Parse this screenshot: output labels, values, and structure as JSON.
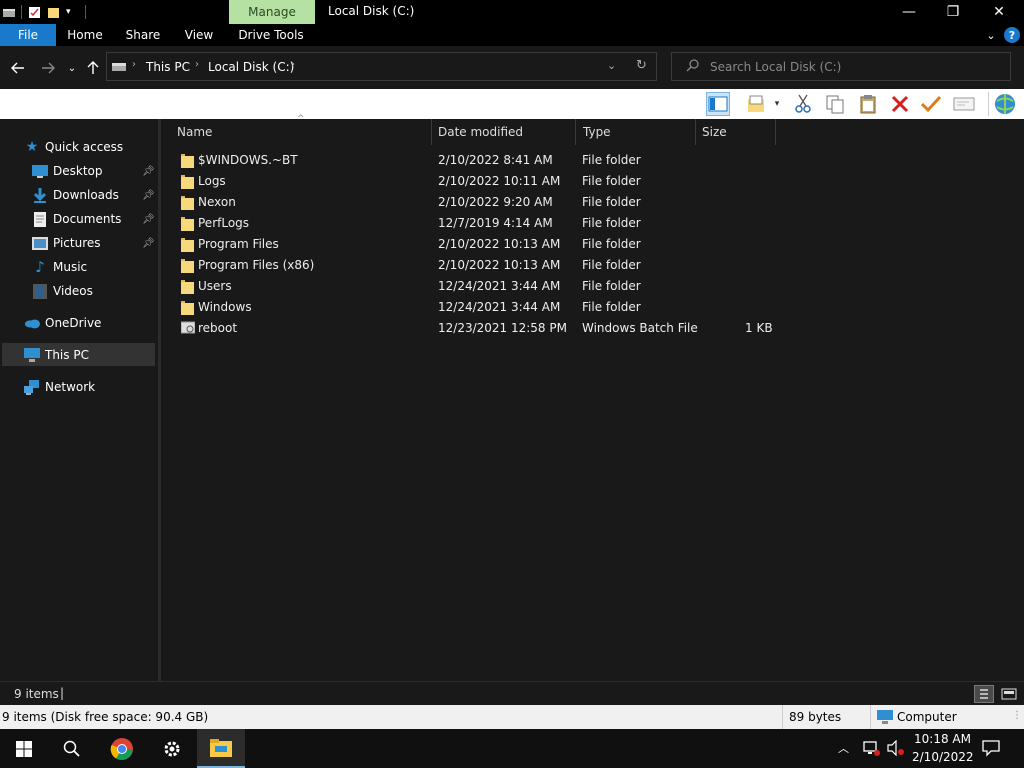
{
  "window": {
    "contextual_tab": "Manage",
    "title": "Local Disk (C:)",
    "minimize": "—",
    "maximize": "❐",
    "close": "✕"
  },
  "ribbon": {
    "tabs": [
      "File",
      "Home",
      "Share",
      "View",
      "Drive Tools"
    ],
    "help": "?"
  },
  "address": {
    "crumbs": [
      "This PC",
      "Local Disk (C:)"
    ],
    "search_placeholder": "Search Local Disk (C:)"
  },
  "nav": {
    "quick_access": "Quick access",
    "items": [
      {
        "label": "Desktop",
        "icon": "desktop-icon",
        "pinned": true
      },
      {
        "label": "Downloads",
        "icon": "downloads-icon",
        "pinned": true
      },
      {
        "label": "Documents",
        "icon": "documents-icon",
        "pinned": true
      },
      {
        "label": "Pictures",
        "icon": "pictures-icon",
        "pinned": true
      },
      {
        "label": "Music",
        "icon": "music-icon",
        "pinned": false
      },
      {
        "label": "Videos",
        "icon": "videos-icon",
        "pinned": false
      }
    ],
    "onedrive": "OneDrive",
    "thispc": "This PC",
    "network": "Network"
  },
  "columns": {
    "name": "Name",
    "date": "Date modified",
    "type": "Type",
    "size": "Size"
  },
  "files": [
    {
      "name": "$WINDOWS.~BT",
      "date": "2/10/2022 8:41 AM",
      "type": "File folder",
      "size": "",
      "kind": "folder"
    },
    {
      "name": "Logs",
      "date": "2/10/2022 10:11 AM",
      "type": "File folder",
      "size": "",
      "kind": "folder"
    },
    {
      "name": "Nexon",
      "date": "2/10/2022 9:20 AM",
      "type": "File folder",
      "size": "",
      "kind": "folder"
    },
    {
      "name": "PerfLogs",
      "date": "12/7/2019 4:14 AM",
      "type": "File folder",
      "size": "",
      "kind": "folder"
    },
    {
      "name": "Program Files",
      "date": "2/10/2022 10:13 AM",
      "type": "File folder",
      "size": "",
      "kind": "folder"
    },
    {
      "name": "Program Files (x86)",
      "date": "2/10/2022 10:13 AM",
      "type": "File folder",
      "size": "",
      "kind": "folder"
    },
    {
      "name": "Users",
      "date": "12/24/2021 3:44 AM",
      "type": "File folder",
      "size": "",
      "kind": "folder"
    },
    {
      "name": "Windows",
      "date": "12/24/2021 3:44 AM",
      "type": "File folder",
      "size": "",
      "kind": "folder"
    },
    {
      "name": "reboot",
      "date": "12/23/2021 12:58 PM",
      "type": "Windows Batch File",
      "size": "1 KB",
      "kind": "batch"
    }
  ],
  "status": {
    "item_count": "9 items",
    "cursor": "|"
  },
  "infobar": {
    "summary": "9 items (Disk free space: 90.4 GB)",
    "size": "89 bytes",
    "location": "Computer"
  },
  "clock": {
    "time": "10:18 AM",
    "date": "2/10/2022"
  },
  "colors": {
    "file_tab": "#1979ca",
    "manage_tab": "#b5e2a3",
    "folder": "#f7d87a",
    "accent_blue": "#1979ca"
  }
}
